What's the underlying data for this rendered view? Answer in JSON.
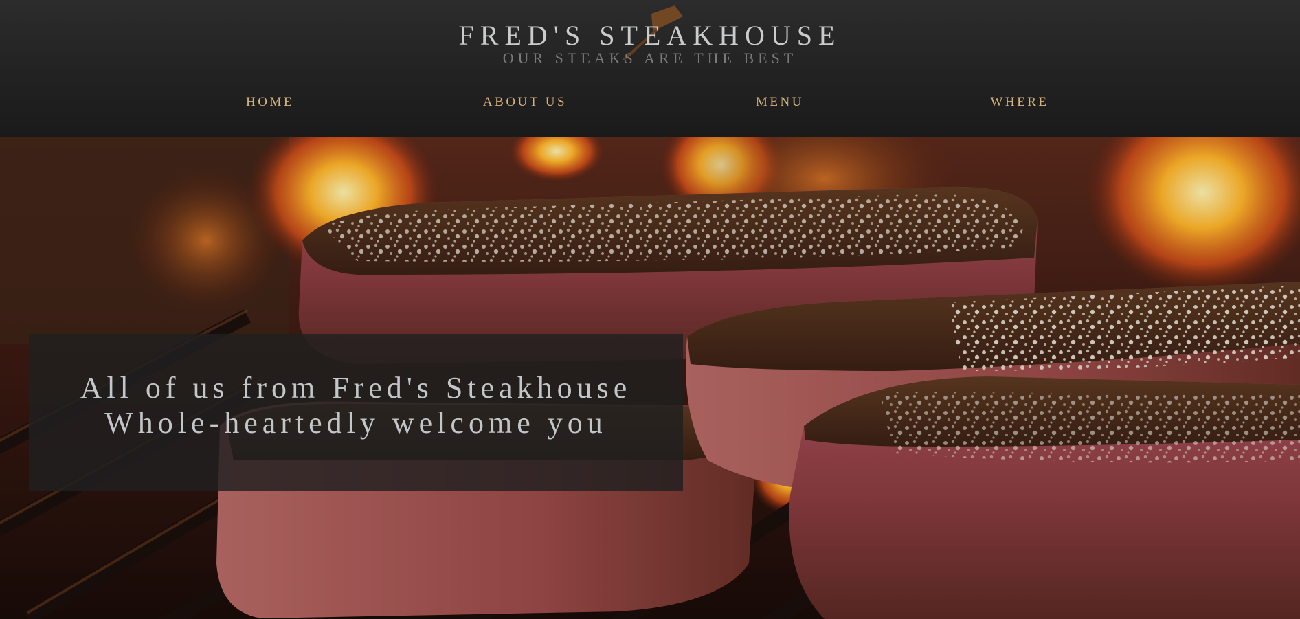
{
  "brand": {
    "title": "FRED'S STEAKHOUSE",
    "tagline": "OUR STEAKS ARE THE BEST",
    "logo_icon": "cleaver-icon",
    "accent_color": "#d8b27a"
  },
  "nav": {
    "items": [
      {
        "label": "HOME"
      },
      {
        "label": "ABOUT US"
      },
      {
        "label": "MENU"
      },
      {
        "label": "WHERE"
      }
    ]
  },
  "hero": {
    "image": "grilled-steaks-on-fire-photo",
    "welcome_text": "All of us from Fred's Steakhouse Whole-heartedly welcome you"
  }
}
